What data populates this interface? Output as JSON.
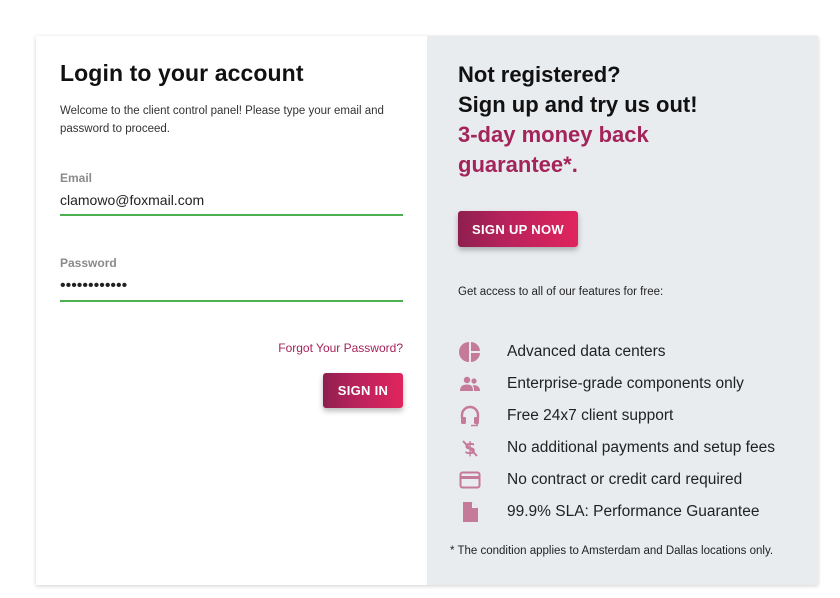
{
  "login": {
    "title": "Login to your account",
    "welcome": "Welcome to the client control panel! Please type your email and password to proceed.",
    "email_label": "Email",
    "email_value": "clamowo@foxmail.com",
    "password_label": "Password",
    "password_value": "••••••••••••",
    "forgot_label": "Forgot Your Password?",
    "signin_label": "SIGN IN"
  },
  "signup": {
    "title_line1": "Not registered?",
    "title_line2": "Sign up and try us out!",
    "accent_line1": "3-day money back",
    "accent_line2": "guarantee*.",
    "button_label": "SIGN UP NOW",
    "get_access": "Get access to all of our features for free:",
    "features": [
      {
        "icon": "pie-chart-icon",
        "label": "Advanced data centers"
      },
      {
        "icon": "people-icon",
        "label": "Enterprise-grade components only"
      },
      {
        "icon": "headset-icon",
        "label": "Free 24x7 client support"
      },
      {
        "icon": "no-money-icon",
        "label": "No additional payments and setup fees"
      },
      {
        "icon": "credit-card-icon",
        "label": "No contract or credit card required"
      },
      {
        "icon": "document-icon",
        "label": "99.9% SLA: Performance Guarantee"
      }
    ],
    "footnote": "* The condition applies to Amsterdam and Dallas locations only."
  },
  "colors": {
    "accent": "#a3245a",
    "button_gradient_start": "#8e1f4f",
    "button_gradient_end": "#e0245e",
    "input_underline": "#4caf50",
    "right_panel_bg": "#e9ecef",
    "icon_color": "#c47a98"
  }
}
